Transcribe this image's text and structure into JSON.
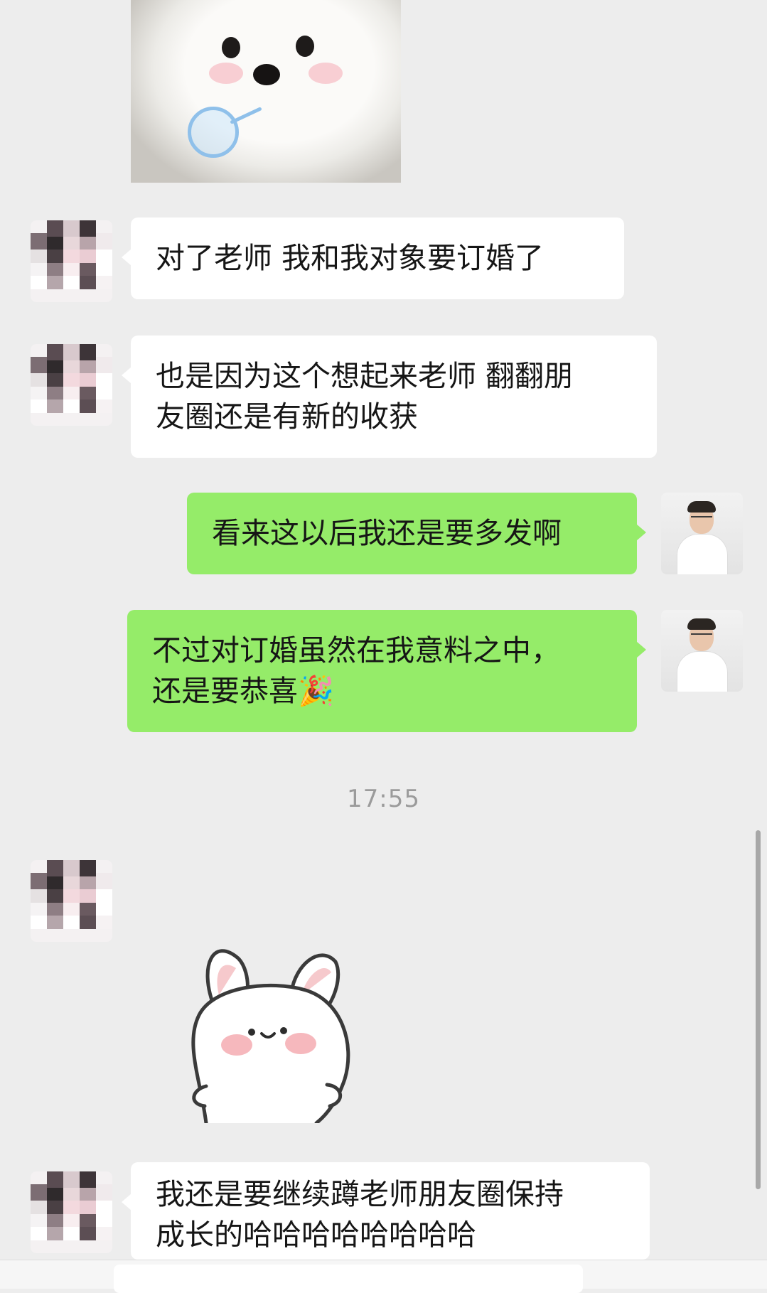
{
  "messages": [
    {
      "text": "对了老师 我和我对象要订婚了"
    },
    {
      "line1": "也是因为这个想起来老师 翻翻朋",
      "line2": "友圈还是有新的收获"
    },
    {
      "text": "看来这以后我还是要多发啊"
    },
    {
      "line1": "不过对订婚虽然在我意料之中，",
      "line2": "还是要恭喜🎉"
    },
    {
      "line1": "我还是要继续蹲老师朋友圈保持",
      "line2": "成长的哈哈哈哈哈哈哈哈"
    }
  ],
  "timestamp": "17:55",
  "stickers": {
    "top": "samoyed-puppy-sticker",
    "bottom": "white-bunny-sticker"
  },
  "colors": {
    "background": "#ededed",
    "incoming_bubble": "#ffffff",
    "outgoing_bubble": "#95ec69"
  }
}
